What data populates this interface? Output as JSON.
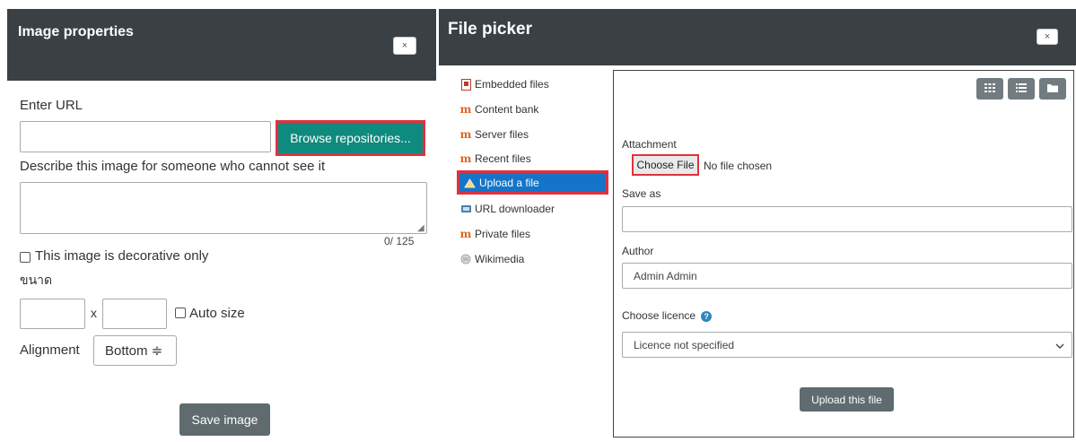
{
  "image_dialog": {
    "title": "Image properties",
    "close_label": "×",
    "enter_url_label": "Enter URL",
    "url_value": "",
    "browse_label": "Browse repositories...",
    "describe_label": "Describe this image for someone who cannot see it",
    "description_value": "",
    "counter": "0/ 125",
    "decorative_label": "This image is decorative only",
    "size_label": "ขนาด",
    "width_value": "",
    "size_x": "x",
    "height_value": "",
    "auto_size_label": "Auto size",
    "alignment_label": "Alignment",
    "alignment_value": "Bottom ≑",
    "save_label": "Save image"
  },
  "file_picker": {
    "title": "File picker",
    "close_label": "×",
    "repositories": [
      {
        "label": "Embedded files",
        "icon": "document-icon"
      },
      {
        "label": "Content bank",
        "icon": "moodle-icon"
      },
      {
        "label": "Server files",
        "icon": "moodle-icon"
      },
      {
        "label": "Recent files",
        "icon": "moodle-icon"
      },
      {
        "label": "Upload a file",
        "icon": "upload-icon",
        "active": true
      },
      {
        "label": "URL downloader",
        "icon": "url-download-icon"
      },
      {
        "label": "Private files",
        "icon": "moodle-icon"
      },
      {
        "label": "Wikimedia",
        "icon": "wikimedia-icon"
      }
    ],
    "view_buttons": [
      "grid-view-icon",
      "list-view-icon",
      "folder-view-icon"
    ],
    "attachment_label": "Attachment",
    "choose_file_label": "Choose File",
    "no_file_text": "No file chosen",
    "save_as_label": "Save as",
    "save_as_value": "",
    "author_label": "Author",
    "author_value": "Admin Admin",
    "licence_label": "Choose licence",
    "licence_value": "Licence not specified",
    "upload_label": "Upload this file",
    "colors": {
      "header": "#3a4044",
      "active": "#1674c8",
      "highlight": "#e0313d",
      "browse": "#0f8a7e"
    }
  }
}
